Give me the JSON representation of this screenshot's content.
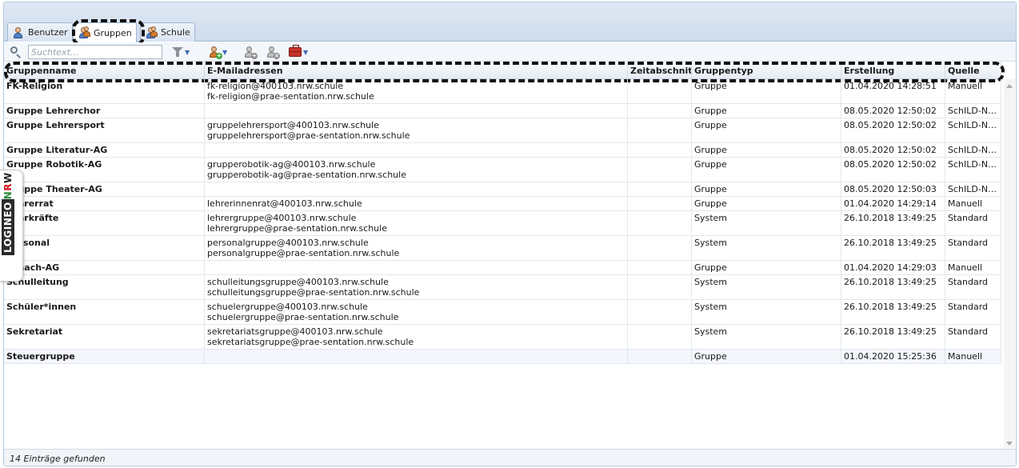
{
  "tabs": [
    {
      "label": "Benutzer",
      "icon": "user-icon"
    },
    {
      "label": "Gruppen",
      "icon": "group-icon",
      "active": true
    },
    {
      "label": "Schule",
      "icon": "school-icon"
    }
  ],
  "toolbar": {
    "search_placeholder": "Suchtext...",
    "filter_icon": "filter-icon",
    "add_group_icon": "add-group-icon",
    "add_member_icon": "add-member-icon",
    "remove_member_icon": "remove-member-icon",
    "tools_icon": "toolbox-icon"
  },
  "columns": [
    "Gruppenname",
    "E-Mailadressen",
    "Zeitabschnitt",
    "Gruppentyp",
    "Erstellung",
    "Quelle"
  ],
  "rows": [
    {
      "name": "FK-Religion",
      "emails": [
        "fk-religion@400103.nrw.schule",
        "fk-religion@prae-sentation.nrw.schule"
      ],
      "period": "",
      "type": "Gruppe",
      "created": "01.04.2020 14:28:51",
      "source": "Manuell"
    },
    {
      "name": "Gruppe Lehrerchor",
      "emails": [],
      "period": "",
      "type": "Gruppe",
      "created": "08.05.2020 12:50:02",
      "source": "SchILD-NRW"
    },
    {
      "name": "Gruppe Lehrersport",
      "emails": [
        "gruppelehrersport@400103.nrw.schule",
        "gruppelehrersport@prae-sentation.nrw.schule"
      ],
      "period": "",
      "type": "Gruppe",
      "created": "08.05.2020 12:50:02",
      "source": "SchILD-NRW"
    },
    {
      "name": "Gruppe Literatur-AG",
      "emails": [],
      "period": "",
      "type": "Gruppe",
      "created": "08.05.2020 12:50:02",
      "source": "SchILD-NRW"
    },
    {
      "name": "Gruppe Robotik-AG",
      "emails": [
        "grupperobotik-ag@400103.nrw.schule",
        "grupperobotik-ag@prae-sentation.nrw.schule"
      ],
      "period": "",
      "type": "Gruppe",
      "created": "08.05.2020 12:50:02",
      "source": "SchILD-NRW"
    },
    {
      "name": "Gruppe Theater-AG",
      "emails": [],
      "period": "",
      "type": "Gruppe",
      "created": "08.05.2020 12:50:03",
      "source": "SchILD-NRW"
    },
    {
      "name": "Lehrerrat",
      "emails": [
        "lehrerinnenrat@400103.nrw.schule"
      ],
      "period": "",
      "type": "Gruppe",
      "created": "01.04.2020 14:29:14",
      "source": "Manuell"
    },
    {
      "name": "Lehrkräfte",
      "emails": [
        "lehrergruppe@400103.nrw.schule",
        "lehrergruppe@prae-sentation.nrw.schule"
      ],
      "period": "",
      "type": "System",
      "created": "26.10.2018 13:49:25",
      "source": "Standard"
    },
    {
      "name": "Personal",
      "emails": [
        "personalgruppe@400103.nrw.schule",
        "personalgruppe@prae-sentation.nrw.schule"
      ],
      "period": "",
      "type": "System",
      "created": "26.10.2018 13:49:25",
      "source": "Standard"
    },
    {
      "name": "Schach-AG",
      "emails": [],
      "period": "",
      "type": "Gruppe",
      "created": "01.04.2020 14:29:03",
      "source": "Manuell"
    },
    {
      "name": "Schulleitung",
      "emails": [
        "schulleitungsgruppe@400103.nrw.schule",
        "schulleitungsgruppe@prae-sentation.nrw.schule"
      ],
      "period": "",
      "type": "System",
      "created": "26.10.2018 13:49:25",
      "source": "Standard"
    },
    {
      "name": "Schüler*innen",
      "emails": [
        "schuelergruppe@400103.nrw.schule",
        "schuelergruppe@prae-sentation.nrw.schule"
      ],
      "period": "",
      "type": "System",
      "created": "26.10.2018 13:49:25",
      "source": "Standard"
    },
    {
      "name": "Sekretariat",
      "emails": [
        "sekretariatsgruppe@400103.nrw.schule",
        "sekretariatsgruppe@prae-sentation.nrw.schule"
      ],
      "period": "",
      "type": "System",
      "created": "26.10.2018 13:49:25",
      "source": "Standard"
    },
    {
      "name": "Steuergruppe",
      "emails": [],
      "period": "",
      "type": "Gruppe",
      "created": "01.04.2020 15:25:36",
      "source": "Manuell"
    }
  ],
  "status": "14 Einträge gefunden",
  "side_logo": {
    "part1": "LOGINEO",
    "part2": "NRW"
  }
}
